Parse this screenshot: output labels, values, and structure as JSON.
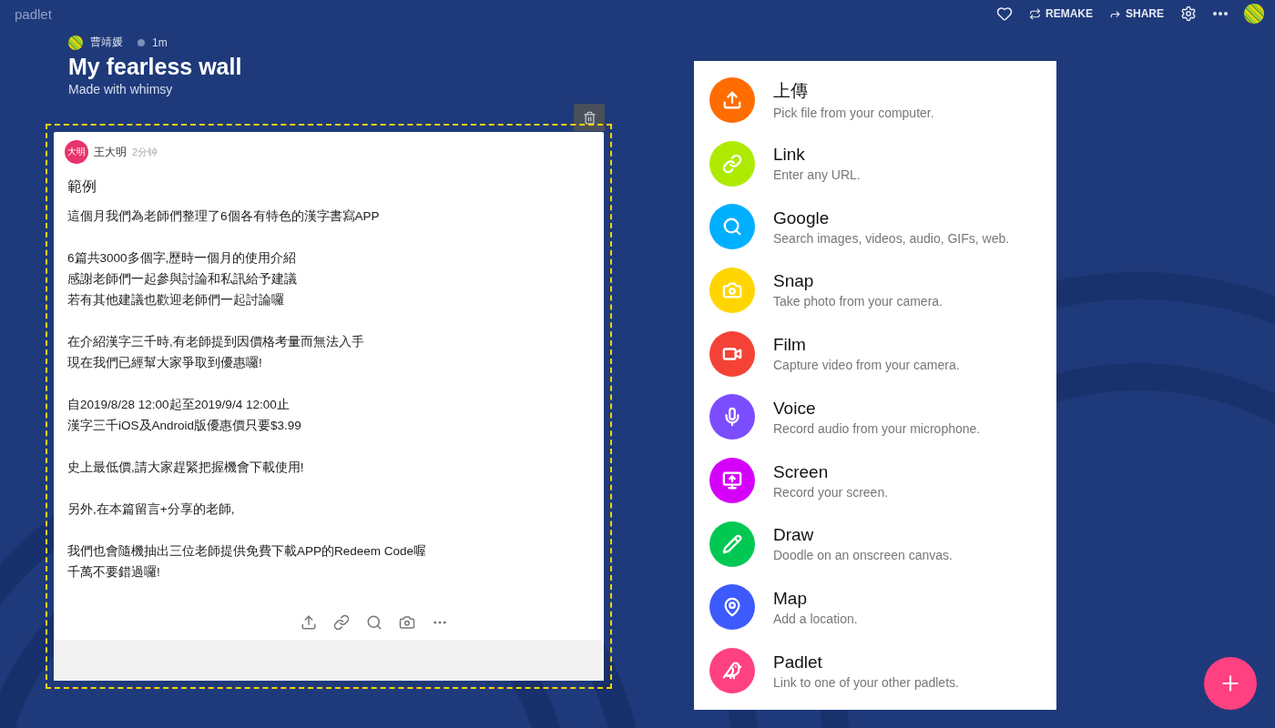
{
  "topbar": {
    "logo": "padlet",
    "actions": [
      {
        "kind": "like"
      },
      {
        "kind": "remake",
        "label": "REMAKE"
      },
      {
        "kind": "share",
        "label": "SHARE"
      },
      {
        "kind": "settings"
      },
      {
        "kind": "more"
      },
      {
        "kind": "avatar"
      }
    ]
  },
  "header": {
    "author": "曹靖媛",
    "age": "1m",
    "title": "My fearless wall",
    "subtitle": "Made with whimsy"
  },
  "post": {
    "author_badge": "大明",
    "author": "王大明",
    "age": "2分钟",
    "subject": "範例",
    "blocks": [
      [
        "這個月我們為老師們整理了6個各有特色的漢字書寫APP"
      ],
      [
        "6篇共3000多個字,歷時一個月的使用介紹",
        "感謝老師們一起參與討論和私訊給予建議",
        "若有其他建議也歡迎老師們一起討論囉"
      ],
      [
        "在介紹漢字三千時,有老師提到因價格考量而無法入手",
        "現在我們已經幫大家爭取到優惠囉!"
      ],
      [
        "自2019/8/28 12:00起至2019/9/4 12:00止",
        "漢字三千iOS及Android版優惠價只要$3.99"
      ],
      [
        "史上最低價,請大家趕緊把握機會下載使用!"
      ],
      [
        "另外,在本篇留言+分享的老師,"
      ],
      [
        "我們也會隨機抽出三位老師提供免費下載APP的Redeem Code喔",
        "千萬不要錯過囉!"
      ]
    ],
    "tools": [
      {
        "kind": "upload"
      },
      {
        "kind": "link"
      },
      {
        "kind": "search"
      },
      {
        "kind": "camera"
      },
      {
        "kind": "more"
      }
    ]
  },
  "attach_menu": [
    {
      "kind": "upload",
      "color": "#ff6d00",
      "title": "上傳",
      "subtitle": "Pick file from your computer."
    },
    {
      "kind": "link",
      "color": "#aeea00",
      "title": "Link",
      "subtitle": "Enter any URL."
    },
    {
      "kind": "google",
      "color": "#00b0ff",
      "title": "Google",
      "subtitle": "Search images, videos, audio, GIFs, web."
    },
    {
      "kind": "snap",
      "color": "#ffd600",
      "title": "Snap",
      "subtitle": "Take photo from your camera."
    },
    {
      "kind": "film",
      "color": "#f44336",
      "title": "Film",
      "subtitle": "Capture video from your camera."
    },
    {
      "kind": "voice",
      "color": "#7c4dff",
      "title": "Voice",
      "subtitle": "Record audio from your microphone."
    },
    {
      "kind": "screen",
      "color": "#d500f9",
      "title": "Screen",
      "subtitle": "Record your screen."
    },
    {
      "kind": "draw",
      "color": "#00c853",
      "title": "Draw",
      "subtitle": "Doodle on an onscreen canvas."
    },
    {
      "kind": "map",
      "color": "#3d5afe",
      "title": "Map",
      "subtitle": "Add a location."
    },
    {
      "kind": "padlet",
      "color": "#ff4081",
      "title": "Padlet",
      "subtitle": "Link to one of your other padlets."
    }
  ]
}
